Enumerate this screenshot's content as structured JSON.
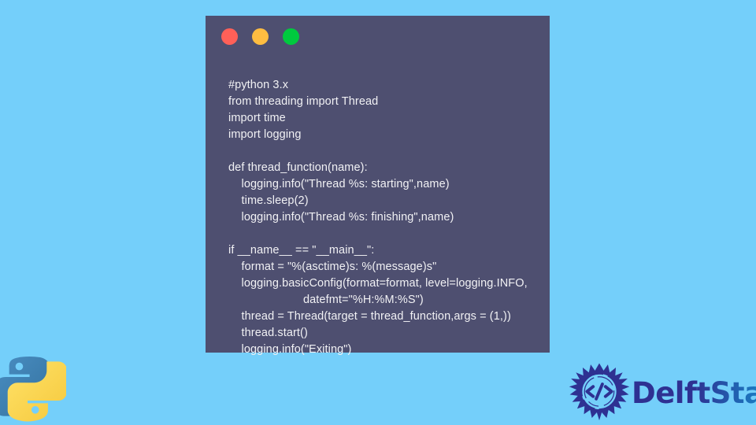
{
  "background": {
    "color": "#74cffa"
  },
  "code_window": {
    "panel_color": "#4e4f70",
    "text_color": "#f1f1f4",
    "titlebar": {
      "close_label": "close",
      "minimize_label": "minimize",
      "maximize_label": "maximize",
      "close_color": "#ff6058",
      "minimize_color": "#ffbd41",
      "maximize_color": "#00ca3e"
    },
    "code_lines": [
      "#python 3.x",
      "from threading import Thread",
      "import time",
      "import logging",
      "",
      "def thread_function(name):",
      "    logging.info(\"Thread %s: starting\",name)",
      "    time.sleep(2)",
      "    logging.info(\"Thread %s: finishing\",name)",
      "",
      "if __name__ == \"__main__\":",
      "    format = \"%(asctime)s: %(message)s\"",
      "    logging.basicConfig(format=format, level=logging.INFO,",
      "                       datefmt=\"%H:%M:%S\")",
      "    thread = Thread(target = thread_function,args = (1,))",
      "    thread.start()",
      "    logging.info(\"Exiting\")"
    ]
  },
  "python_logo": {
    "name": "python-logo",
    "blue": "#3c78ab",
    "yellow": "#ffd95b"
  },
  "delftstack_logo": {
    "wordmark": "DelftStack",
    "gradient_start": "#2e3192",
    "gradient_end": "#1b86d8"
  }
}
